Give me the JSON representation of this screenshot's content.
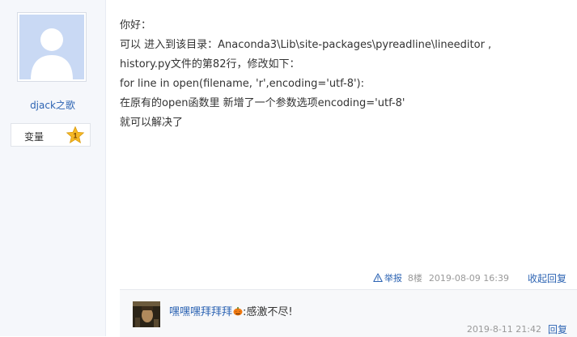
{
  "author": {
    "name": "djack之歌",
    "level_label": "变量",
    "level_number": "1"
  },
  "post": {
    "lines": [
      "你好：",
      "可以 进入到该目录：Anaconda3\\Lib\\site-packages\\pyreadline\\lineeditor ,",
      "history.py文件的第82行，修改如下：",
      "for line in open(filename, 'r',encoding='utf-8'):",
      "在原有的open函数里 新增了一个参数选项encoding='utf-8'",
      "就可以解决了"
    ],
    "report_label": "举报",
    "floor": "8楼",
    "time": "2019-08-09 16:39",
    "collapse_label": "收起回复"
  },
  "reply": {
    "user": "嘿嘿嘿拜拜拜",
    "text": ":感激不尽!",
    "time": "2019-8-11 21:42",
    "reply_label": "回复"
  },
  "colors": {
    "link": "#2d64b3",
    "sidebar_bg": "#f5f7fb",
    "star": "#f6b824"
  }
}
